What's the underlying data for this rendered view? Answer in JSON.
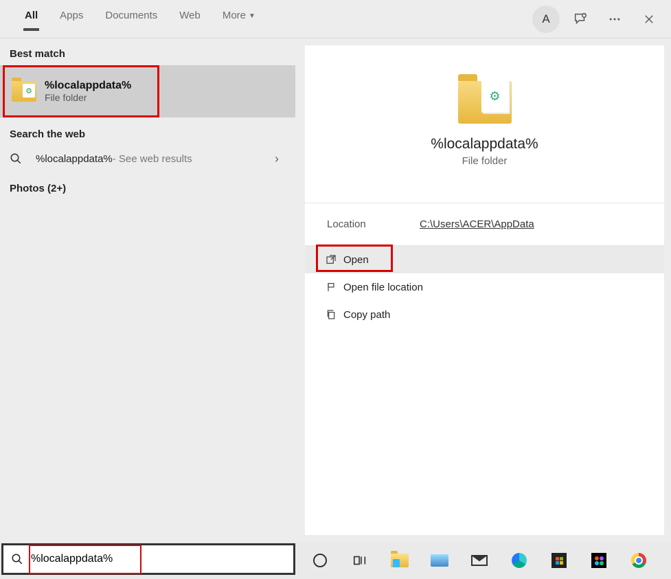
{
  "tabs": {
    "all": "All",
    "apps": "Apps",
    "documents": "Documents",
    "web": "Web",
    "more": "More"
  },
  "avatar_initial": "A",
  "sections": {
    "best_match": "Best match",
    "search_web": "Search the web",
    "photos": "Photos (2+)"
  },
  "best": {
    "title": "%localappdata%",
    "subtitle": "File folder"
  },
  "web_result": {
    "query": "%localappdata%",
    "suffix": " - See web results"
  },
  "preview": {
    "title": "%localappdata%",
    "subtitle": "File folder",
    "location_label": "Location",
    "location_value": "C:\\Users\\ACER\\AppData"
  },
  "actions": {
    "open": "Open",
    "open_location": "Open file location",
    "copy_path": "Copy path"
  },
  "search_value": "%localappdata%"
}
